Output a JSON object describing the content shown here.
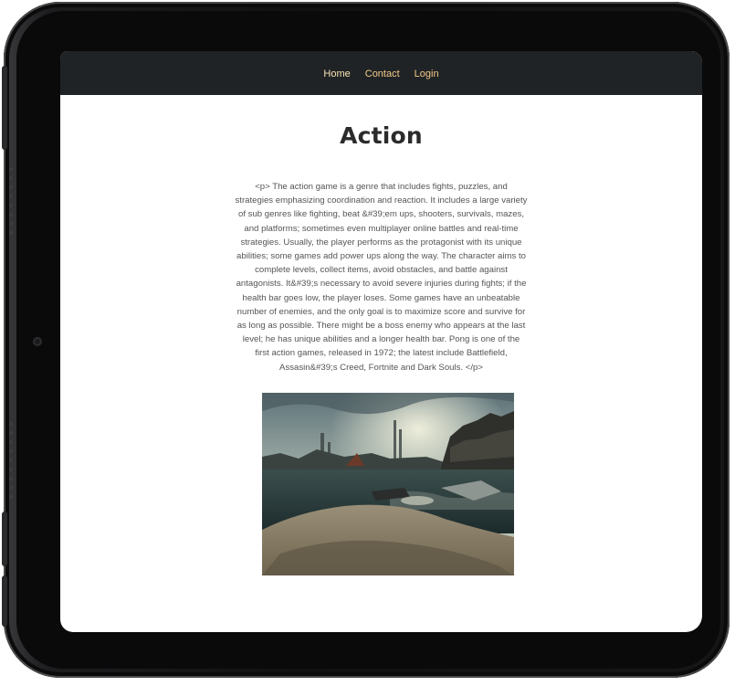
{
  "nav": {
    "home": "Home",
    "contact": "Contact",
    "login": "Login"
  },
  "page": {
    "title": "Action",
    "body": "<p> The action game is a genre that includes fights, puzzles, and strategies emphasizing coordination and reaction. It includes a large variety of sub genres like fighting, beat &#39;em ups, shooters, survivals, mazes, and platforms; sometimes even multiplayer online battles and real-time strategies. Usually, the player performs as the protagonist with its unique abilities; some games add power ups along the way. The character aims to complete levels, collect items, avoid obstacles, and battle against antagonists. It&#39;s necessary to avoid severe injuries during fights; if the health bar goes low, the player loses. Some games have an unbeatable number of enemies, and the only goal is to maximize score and survive for as long as possible. There might be a boss enemy who appears at the last level; he has unique abilities and a longer health bar. Pong is one of the first action games, released in 1972; the latest include Battlefield, Assasin&#39;s Creed, Fortnite and Dark Souls. </p>"
  },
  "image": {
    "alt": "",
    "subject": "game-screenshot-harbor"
  },
  "colors": {
    "navbar_bg": "#202325",
    "nav_link": "#f3c98a",
    "device_body": "#111112",
    "screen_bg": "#ffffff"
  }
}
